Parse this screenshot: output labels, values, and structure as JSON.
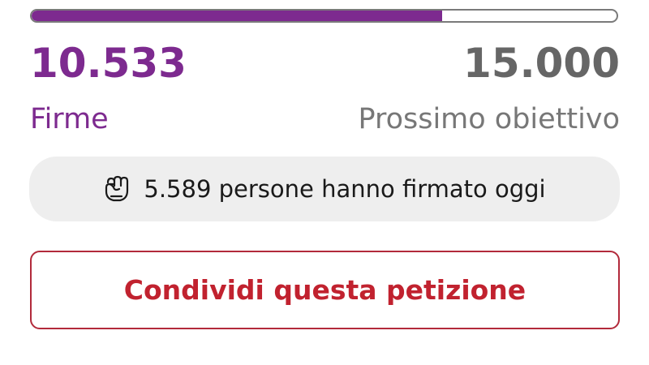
{
  "progress": {
    "current_value": 10533,
    "goal_value": 15000,
    "fraction_filled": 0.7022
  },
  "signatures": {
    "count_label": "10.533",
    "caption": "Firme"
  },
  "goal": {
    "count_label": "15.000",
    "caption": "Prossimo obiettivo"
  },
  "today": {
    "icon": "raised-fist-icon",
    "text": "5.589 persone hanno firmato oggi"
  },
  "share": {
    "label": "Condividi questa petizione"
  },
  "colors": {
    "accent_purple": "#7d2a8f",
    "goal_gray": "#666666",
    "share_red": "#c1222f",
    "pill_background": "#eeeeee"
  }
}
